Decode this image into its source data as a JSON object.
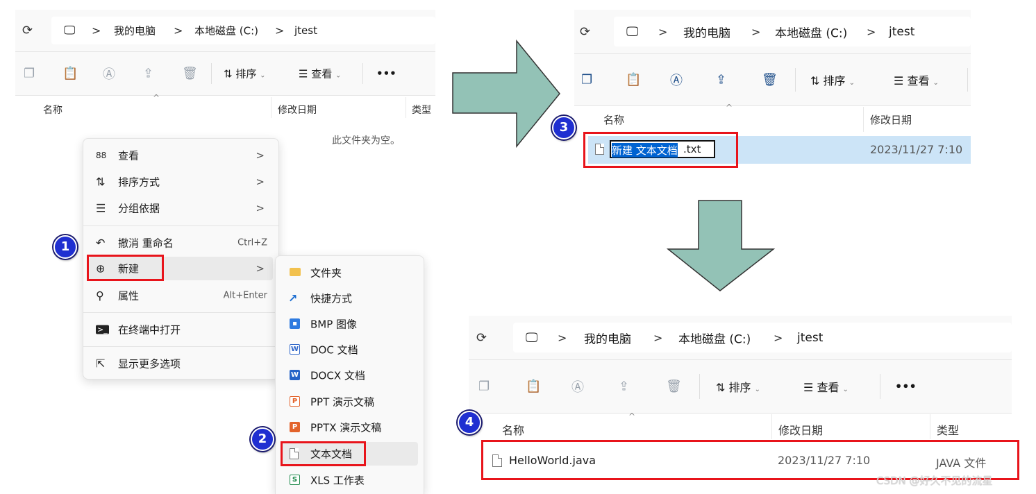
{
  "common": {
    "refresh_icon": "⟳",
    "pc_icon": "computer-icon",
    "sep": ">",
    "crumb_pc": "我的电脑",
    "crumb_drive": "本地磁盘 (C:)",
    "crumb_folder": "jtest",
    "sort_label": "排序",
    "view_label": "查看",
    "more_label": "•••",
    "col_name": "名称",
    "col_date": "修改日期",
    "col_type": "类型"
  },
  "left": {
    "empty_text": "此文件夹为空。",
    "context_menu": [
      {
        "icon": "88",
        "label": "查看",
        "arrow": ">"
      },
      {
        "icon": "⇅",
        "label": "排序方式",
        "arrow": ">"
      },
      {
        "icon": "☰",
        "label": "分组依据",
        "arrow": ">"
      },
      {
        "icon": "↶",
        "label": "撤消 重命名",
        "shortcut": "Ctrl+Z"
      },
      {
        "icon": "⊕",
        "label": "新建",
        "arrow": ">"
      },
      {
        "icon": "⚲",
        "label": "属性",
        "shortcut": "Alt+Enter"
      },
      {
        "icon": ">_",
        "label": "在终端中打开"
      },
      {
        "icon": "⇱",
        "label": "显示更多选项"
      }
    ],
    "submenu": [
      {
        "label": "文件夹",
        "color": "#f2c14e"
      },
      {
        "label": "快捷方式",
        "color": "#1f6fd1"
      },
      {
        "label": "BMP 图像",
        "color": "#2f7be0"
      },
      {
        "label": "DOC 文档",
        "color": "#2f66c9"
      },
      {
        "label": "DOCX 文档",
        "color": "#2563c7"
      },
      {
        "label": "PPT 演示文稿",
        "color": "#e3632b"
      },
      {
        "label": "PPTX 演示文稿",
        "color": "#e3632b"
      },
      {
        "label": "文本文档",
        "color": "#888888"
      },
      {
        "label": "XLS 工作表",
        "color": "#1f8a4c"
      }
    ]
  },
  "top_right": {
    "file_selected": "新建 文本文档",
    "file_ext": ".txt",
    "date": "2023/11/27 7:10"
  },
  "bottom_right": {
    "file_name": "HelloWorld.java",
    "date": "2023/11/27 7:10",
    "type": "JAVA 文件"
  },
  "badges": [
    "1",
    "2",
    "3",
    "4"
  ],
  "watermark": "CSDN @好久不见的流星",
  "colors": {
    "highlight": "#e8141b",
    "badge": "#1f2fd1",
    "arrow": "#93c2b6",
    "selection": "#cce4f7"
  }
}
